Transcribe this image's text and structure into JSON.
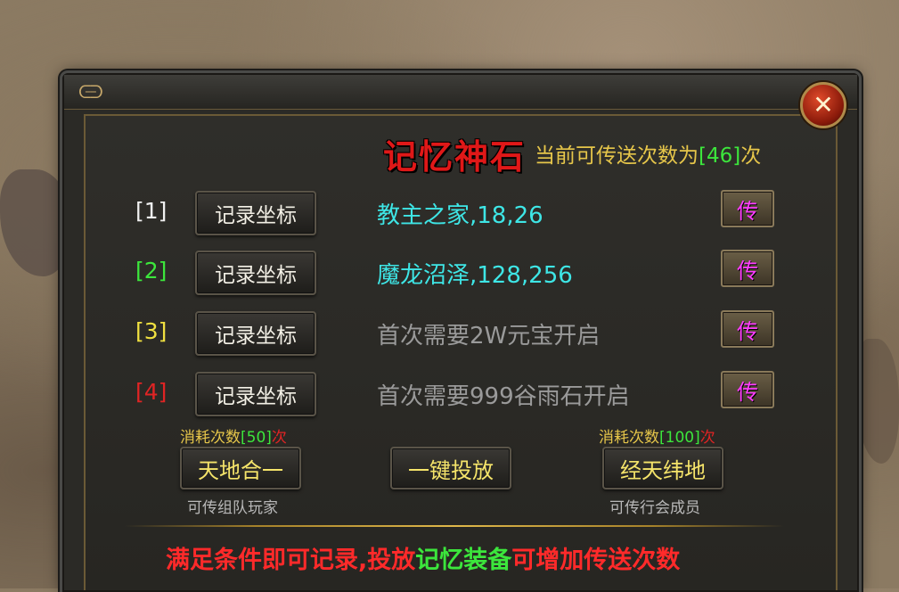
{
  "title": "记忆神石",
  "info": {
    "prefix": "当前可传送次数为",
    "count": "[46]",
    "suffix": "次"
  },
  "slots": [
    {
      "index": "[1]",
      "index_color": "#f0f0f0",
      "record_label": "记录坐标",
      "location": "教主之家,18,26",
      "location_color": "cyan",
      "send_label": "传"
    },
    {
      "index": "[2]",
      "index_color": "#3ce63c",
      "record_label": "记录坐标",
      "location": "魔龙沼泽,128,256",
      "location_color": "cyan",
      "send_label": "传"
    },
    {
      "index": "[3]",
      "index_color": "#f0e040",
      "record_label": "记录坐标",
      "location": "首次需要2W元宝开启",
      "location_color": "gray",
      "send_label": "传"
    },
    {
      "index": "[4]",
      "index_color": "#e02424",
      "record_label": "记录坐标",
      "location": "首次需要999谷雨石开启",
      "location_color": "gray",
      "send_label": "传"
    }
  ],
  "actions": {
    "left": {
      "cost_prefix": "消耗次数",
      "cost_num": "[50]",
      "cost_suffix": "次",
      "label": "天地合一",
      "sub": "可传组队玩家"
    },
    "middle": {
      "label": "一键投放"
    },
    "right": {
      "cost_prefix": "消耗次数",
      "cost_num": "[100]",
      "cost_suffix": "次",
      "label": "经天纬地",
      "sub": "可传行会成员"
    }
  },
  "footer": {
    "part1": "满足条件即可记录,投放",
    "part2": "记忆装备",
    "part3": "可增加传送次数"
  },
  "icons": {
    "close": "close-icon",
    "ornament": "corner-ornament-icon"
  },
  "colors": {
    "title": "#e01818",
    "gold": "#e6c64a",
    "green": "#3ce63c",
    "cyan": "#3ee6e6",
    "magenta": "#ff3cff"
  }
}
